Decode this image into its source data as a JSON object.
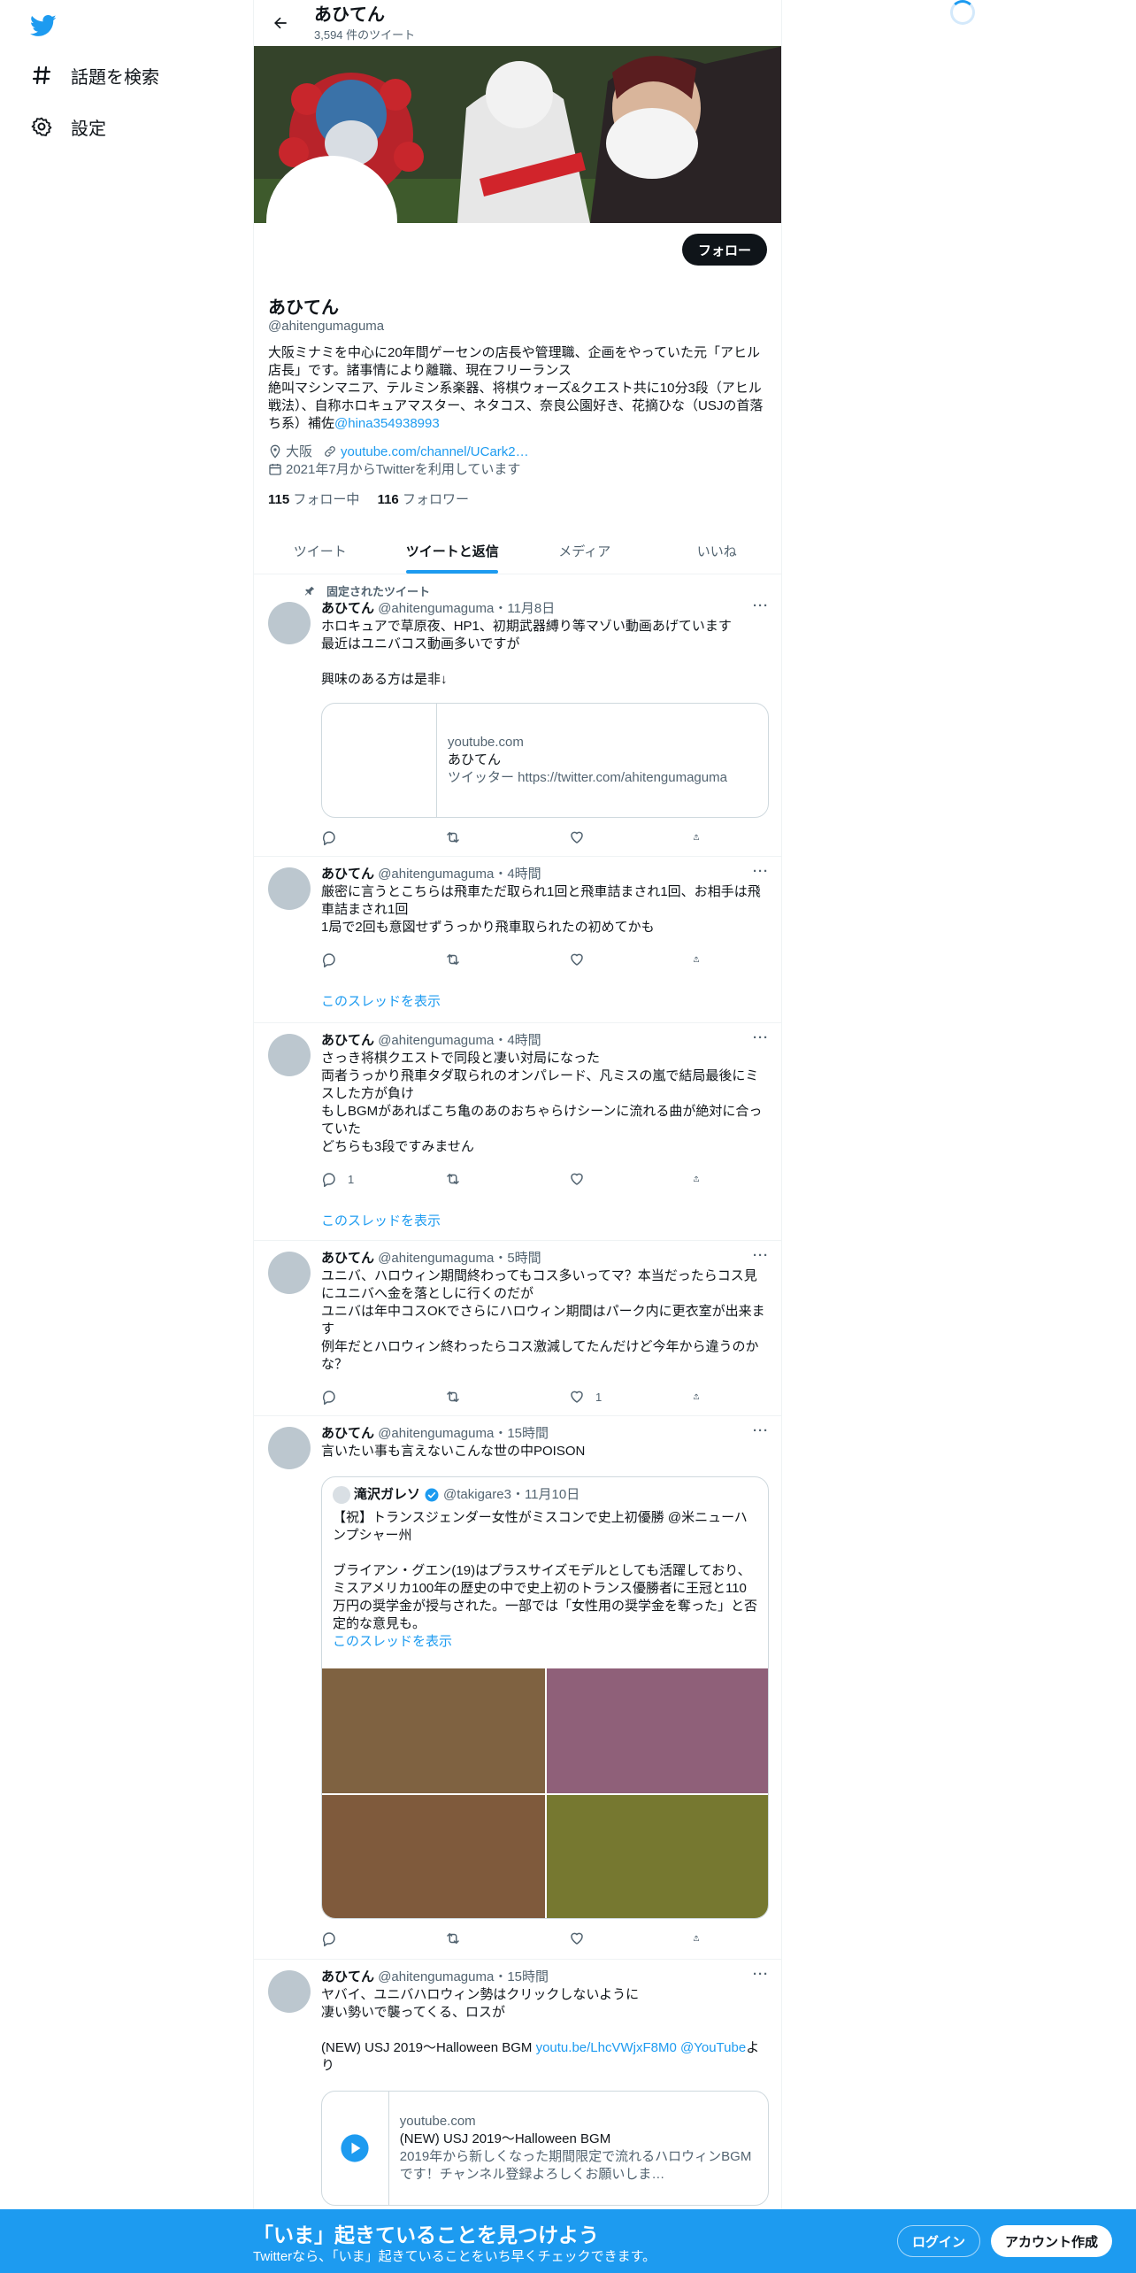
{
  "nav": {
    "explore_label": "話題を検索",
    "settings_label": "設定"
  },
  "header": {
    "name": "あひてん",
    "tweet_count": "3,594 件のツイート"
  },
  "profile": {
    "follow_label": "フォロー",
    "name": "あひてん",
    "handle": "@ahitengumaguma",
    "bio": "大阪ミナミを中心に20年間ゲーセンの店長や管理職、企画をやっていた元「アヒル店長」です。諸事情により離職、現在フリーランス\n絶叫マシンマニア、テルミン系楽器、将棋ウォーズ&クエスト共に10分3段（アヒル戦法）、自称ホロキュアマスター、ネタコス、奈良公園好き、花摘ひな（USJの首落ち系）補佐",
    "bio_mention": "@hina354938993",
    "location": "大阪",
    "link": "youtube.com/channel/UCark2…",
    "joined": "2021年7月からTwitterを利用しています",
    "following_count": "115",
    "following_label": "フォロー中",
    "followers_count": "116",
    "followers_label": "フォロワー"
  },
  "tabs": [
    "ツイート",
    "ツイートと返信",
    "メディア",
    "いいね"
  ],
  "tweets": [
    {
      "pinned_label": "固定されたツイート",
      "name": "あひてん",
      "handle": "@ahitengumaguma",
      "time": "・11月8日",
      "text": "ホロキュアで草原夜、HP1、初期武器縛り等マゾい動画あげています\n最近はユニバコス動画多いですが\n\n興味のある方は是非↓",
      "card": {
        "domain": "youtube.com",
        "title": "あひてん",
        "desc": "ツイッター https://twitter.com/ahitengumaguma"
      }
    },
    {
      "name": "あひてん",
      "handle": "@ahitengumaguma",
      "time": "・4時間",
      "text": "厳密に言うとこちらは飛車ただ取られ1回と飛車詰まされ1回、お相手は飛車詰まされ1回\n1局で2回も意図せずうっかり飛車取られたの初めてかも",
      "thread_label": "このスレッドを表示"
    },
    {
      "name": "あひてん",
      "handle": "@ahitengumaguma",
      "time": "・4時間",
      "text": "さっき将棋クエストで同段と凄い対局になった\n両者うっかり飛車タダ取られのオンパレード、凡ミスの嵐で結局最後にミスした方が負け\nもしBGMがあればこち亀のあのおちゃらけシーンに流れる曲が絶対に合っていた\nどちらも3段ですみません",
      "reply_count": "1",
      "thread_label": "このスレッドを表示"
    },
    {
      "name": "あひてん",
      "handle": "@ahitengumaguma",
      "time": "・5時間",
      "text": "ユニバ、ハロウィン期間終わってもコス多いってマ？本当だったらコス見にユニバへ金を落としに行くのだが\nユニバは年中コスOKでさらにハロウィン期間はパーク内に更衣室が出来ます\n例年だとハロウィン終わったらコス激減してたんだけど今年から違うのかな？",
      "like_count": "1"
    },
    {
      "name": "あひてん",
      "handle": "@ahitengumaguma",
      "time": "・15時間",
      "text": "言いたい事も言えないこんな世の中POISON",
      "quote": {
        "name": "滝沢ガレソ",
        "handle": "@takigare3",
        "time": "・11月10日",
        "text": "【祝】トランスジェンダー女性がミスコンで史上初優勝 @米ニューハンプシャー州\n\nブライアン・グエン(19)はプラスサイズモデルとしても活躍しており、ミスアメリカ100年の歴史の中で史上初のトランス優勝者に王冠と110万円の奨学金が授与された。一部では「女性用の奨学金を奪った」と否定的な意見も。",
        "thread_label": "このスレッドを表示"
      }
    },
    {
      "name": "あひてん",
      "handle": "@ahitengumaguma",
      "time": "・15時間",
      "text": "ヤバイ、ユニバハロウィン勢はクリックしないように\n凄い勢いで襲ってくる、ロスが\n\n(NEW) USJ 2019〜Halloween BGM ",
      "link_text": "youtu.be/LhcVWjxF8M0",
      "mention": "@YouTube",
      "tail": "より",
      "card": {
        "domain": "youtube.com",
        "title": "(NEW) USJ 2019〜Halloween BGM",
        "desc": "2019年から新しくなった期間限定で流れるハロウィンBGMです！チャンネル登録よろしくお願いしま…"
      }
    }
  ],
  "bottom": {
    "title": "「いま」起きていることを見つけよう",
    "subtitle": "Twitterなら、「いま」起きていることをいち早くチェックできます。",
    "login_label": "ログイン",
    "signup_label": "アカウント作成"
  },
  "colors": {
    "accent": "#1d9bf0",
    "text": "#0f1419",
    "muted": "#536471",
    "media_1": "#7f6241",
    "media_2": "#8f6079",
    "media_3": "#7f5a3c",
    "media_4": "#767830"
  },
  "icons": [
    "twitter-logo-icon",
    "hashtag-icon",
    "gear-icon",
    "back-arrow-icon",
    "location-icon",
    "link-icon",
    "calendar-icon",
    "pin-icon",
    "reply-icon",
    "retweet-icon",
    "like-icon",
    "share-icon",
    "verified-icon",
    "play-icon",
    "loading-spinner"
  ]
}
